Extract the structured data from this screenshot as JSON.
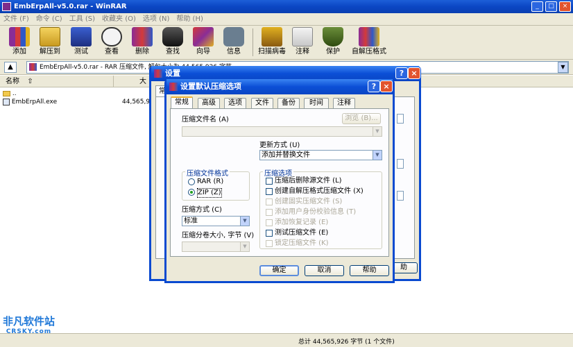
{
  "window": {
    "title": "EmbErpAll-v5.0.rar - WinRAR"
  },
  "menu": [
    "文件 (F)",
    "命令 (C)",
    "工具 (S)",
    "收藏夹 (O)",
    "选项 (N)",
    "帮助 (H)"
  ],
  "toolbar": [
    {
      "label": "添加",
      "icon": "add-archive-icon"
    },
    {
      "label": "解压到",
      "icon": "extract-to-icon"
    },
    {
      "label": "测试",
      "icon": "test-icon"
    },
    {
      "label": "查看",
      "icon": "view-icon"
    },
    {
      "label": "删除",
      "icon": "delete-icon"
    },
    {
      "label": "查找",
      "icon": "find-icon"
    },
    {
      "label": "向导",
      "icon": "wizard-icon"
    },
    {
      "label": "信息",
      "icon": "info-icon"
    },
    {
      "label": "扫描病毒",
      "icon": "virus-scan-icon"
    },
    {
      "label": "注释",
      "icon": "comment-icon"
    },
    {
      "label": "保护",
      "icon": "protect-icon"
    },
    {
      "label": "自解压格式",
      "icon": "sfx-icon"
    }
  ],
  "address": {
    "path": "EmbErpAll-v5.0.rar - RAR 压缩文件, 解包大小为 44,565,926 字节"
  },
  "list": {
    "columns": [
      "名称",
      "大"
    ],
    "rows": [
      {
        "name": "..",
        "size": ""
      },
      {
        "name": "EmbErpAll.exe",
        "size": "44,565,9"
      }
    ]
  },
  "status": {
    "text": "总计 44,565,926 字节 (1 个文件)"
  },
  "watermark": {
    "text": "非凡软件站",
    "sub": "CRSKY.com"
  },
  "dialog_back": {
    "title": "设置",
    "tab_first": "常",
    "help_btn": "助"
  },
  "dialog": {
    "title": "设置默认压缩选项",
    "tabs": [
      "常规",
      "高级",
      "选项",
      "文件",
      "备份",
      "时间",
      "注释"
    ],
    "archive_name_label": "压缩文件名 (A)",
    "browse_btn": "浏览 (B)...",
    "update_mode_label": "更新方式 (U)",
    "update_mode_value": "添加并替换文件",
    "format_group": "压缩文件格式",
    "format_rar": "RAR (R)",
    "format_zip": "ZIP (Z)",
    "method_label": "压缩方式 (C)",
    "method_value": "标准",
    "split_label": "压缩分卷大小, 字节 (V)",
    "options_group": "压缩选项",
    "options": [
      {
        "label": "压缩后删除源文件 (L)",
        "enabled": true
      },
      {
        "label": "创建自解压格式压缩文件 (X)",
        "enabled": true
      },
      {
        "label": "创建固实压缩文件 (S)",
        "enabled": false
      },
      {
        "label": "添加用户身份校验信息 (T)",
        "enabled": false
      },
      {
        "label": "添加恢复记录 (E)",
        "enabled": false
      },
      {
        "label": "测试压缩文件 (E)",
        "enabled": true
      },
      {
        "label": "锁定压缩文件 (K)",
        "enabled": false
      }
    ],
    "ok_btn": "确定",
    "cancel_btn": "取消",
    "help_btn": "帮助"
  }
}
